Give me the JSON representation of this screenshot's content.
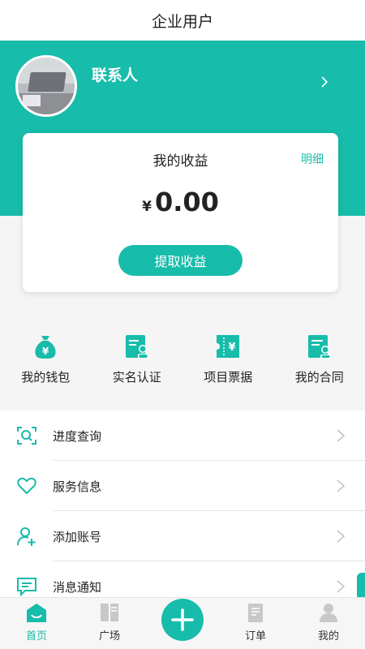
{
  "title": "企业用户",
  "profile": {
    "name": "联系人"
  },
  "earnings": {
    "title": "我的收益",
    "detail_link": "明细",
    "currency": "¥",
    "amount": "0.00",
    "withdraw_label": "提取收益"
  },
  "quick_actions": [
    {
      "label": "我的钱包",
      "icon": "money-bag-icon"
    },
    {
      "label": "实名认证",
      "icon": "id-card-icon"
    },
    {
      "label": "项目票据",
      "icon": "ticket-icon"
    },
    {
      "label": "我的合同",
      "icon": "contract-icon"
    }
  ],
  "menu": [
    {
      "label": "进度查询",
      "icon": "search-scan-icon"
    },
    {
      "label": "服务信息",
      "icon": "heart-icon"
    },
    {
      "label": "添加账号",
      "icon": "add-user-icon"
    },
    {
      "label": "消息通知",
      "icon": "message-icon"
    }
  ],
  "tabbar": [
    {
      "label": "首页",
      "active": true
    },
    {
      "label": "广场",
      "active": false
    },
    {
      "label": "订单",
      "active": false
    },
    {
      "label": "我的",
      "active": false
    }
  ],
  "colors": {
    "accent": "#17bcaa",
    "inactive_icon": "#c8c8c8"
  }
}
